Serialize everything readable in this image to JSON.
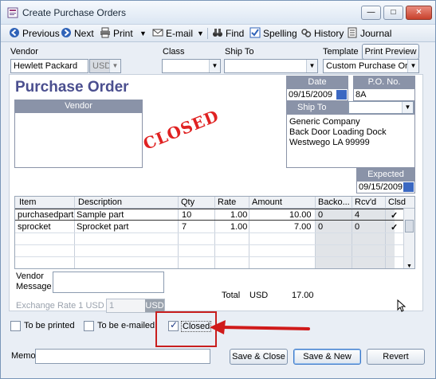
{
  "window": {
    "title": "Create Purchase Orders"
  },
  "toolbar": {
    "previous": "Previous",
    "next": "Next",
    "print": "Print",
    "email": "E-mail",
    "find": "Find",
    "spelling": "Spelling",
    "history": "History",
    "journal": "Journal"
  },
  "header": {
    "vendor_label": "Vendor",
    "vendor_value": "Hewlett Packard",
    "currency": "USD",
    "class_label": "Class",
    "class_value": "",
    "shipto_label": "Ship To",
    "shipto_value": "",
    "template_label": "Template",
    "print_preview": "Print Preview",
    "template_value": "Custom Purchase Or..."
  },
  "form": {
    "title": "Purchase Order",
    "vendor_box": "Vendor",
    "date_label": "Date",
    "date_value": "09/15/2009",
    "po_label": "P.O. No.",
    "po_value": "8A",
    "shipto_box": "Ship To",
    "shipto_lines": [
      "Generic Company",
      "Back Door Loading Dock",
      "Westwego LA 99999"
    ],
    "stamp": "CLOSED",
    "expected_label": "Expected",
    "expected_value": "09/15/2009"
  },
  "items": {
    "columns": [
      "Item",
      "Description",
      "Qty",
      "Rate",
      "Amount",
      "Backo...",
      "Rcv'd",
      "Clsd"
    ],
    "rows": [
      {
        "item": "purchasedpart",
        "description": "Sample part",
        "qty": "10",
        "rate": "1.00",
        "amount": "10.00",
        "backo": "0",
        "rcvd": "4",
        "clsd": "✓"
      },
      {
        "item": "sprocket",
        "description": "Sprocket part",
        "qty": "7",
        "rate": "1.00",
        "amount": "7.00",
        "backo": "0",
        "rcvd": "0",
        "clsd": "✓"
      }
    ]
  },
  "footer": {
    "vendor_message_line1": "Vendor",
    "vendor_message_line2": "Message",
    "total_label": "Total",
    "total_currency": "USD",
    "total_value": "17.00",
    "exchange_label": "Exchange Rate 1 USD =",
    "exchange_value": "1",
    "exchange_currency": "USD",
    "to_be_printed": "To be printed",
    "to_be_emailed": "To be e-mailed",
    "closed": "Closed",
    "memo_label": "Memo",
    "save_close": "Save & Close",
    "save_new": "Save & New",
    "revert": "Revert"
  },
  "colors": {
    "accent": "#4b4f8f",
    "stamp": "#e02222",
    "annotation": "#d01a1a"
  }
}
